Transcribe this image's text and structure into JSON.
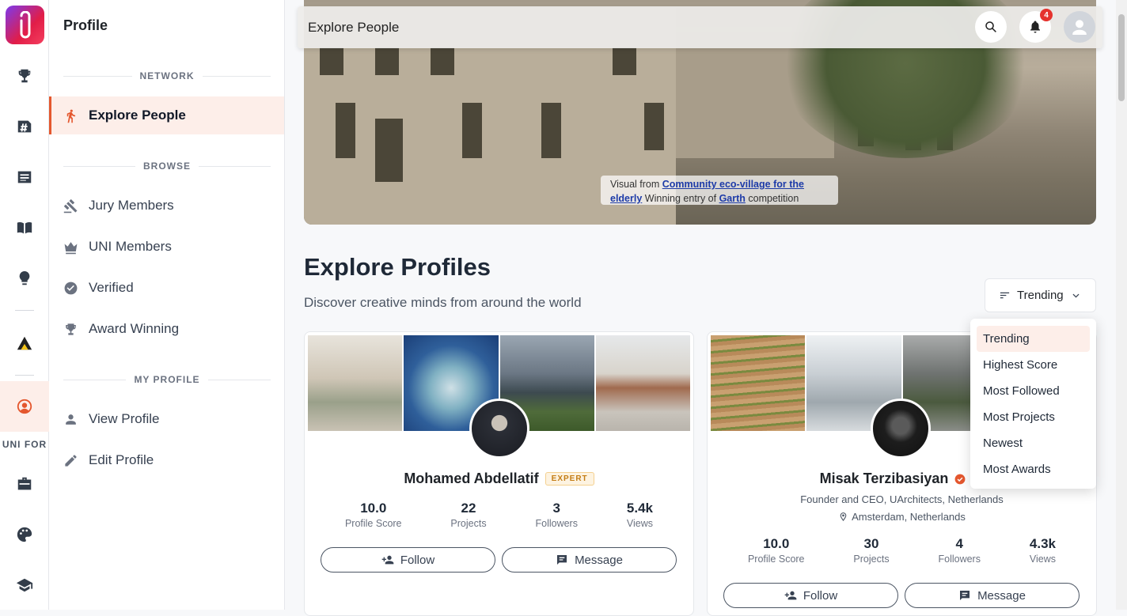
{
  "rail": {
    "label": "UNI FOR",
    "icons": [
      "trophy-icon",
      "hashtag-board-icon",
      "news-icon",
      "book-icon",
      "lightbulb-icon",
      "architecture-logo-icon",
      "profile-circle-icon",
      "briefcase-icon",
      "palette-icon",
      "graduation-cap-icon"
    ]
  },
  "sidenav": {
    "title": "Profile",
    "sections": {
      "network": "NETWORK",
      "browse": "BROWSE",
      "my_profile": "MY PROFILE"
    },
    "items": {
      "explore_people": "Explore People",
      "jury_members": "Jury Members",
      "uni_members": "UNI Members",
      "verified": "Verified",
      "award_winning": "Award Winning",
      "view_profile": "View Profile",
      "edit_profile": "Edit Profile"
    }
  },
  "topbar": {
    "title": "Explore People",
    "notification_count": "4"
  },
  "hero": {
    "caption_prefix": "Visual from ",
    "caption_link1": "Community eco-village for the elderly",
    "caption_mid": " Winning entry of ",
    "caption_link2": "Garth",
    "caption_suffix": " competition"
  },
  "main": {
    "heading": "Explore Profiles",
    "subheading": "Discover creative minds from around the world",
    "sort_label": "Trending"
  },
  "sort_options": [
    "Trending",
    "Highest Score",
    "Most Followed",
    "Most Projects",
    "Newest",
    "Most Awards"
  ],
  "profiles": [
    {
      "name": "Mohamed Abdellatif",
      "badge": "EXPERT",
      "stats": [
        {
          "value": "10.0",
          "label": "Profile Score"
        },
        {
          "value": "22",
          "label": "Projects"
        },
        {
          "value": "3",
          "label": "Followers"
        },
        {
          "value": "5.4k",
          "label": "Views"
        }
      ],
      "follow_label": "Follow",
      "message_label": "Message"
    },
    {
      "name": "Misak Terzibasiyan",
      "role": "Founder and CEO, UArchitects, Netherlands",
      "location": "Amsterdam, Netherlands",
      "stats": [
        {
          "value": "10.0",
          "label": "Profile Score"
        },
        {
          "value": "30",
          "label": "Projects"
        },
        {
          "value": "4",
          "label": "Followers"
        },
        {
          "value": "4.3k",
          "label": "Views"
        }
      ],
      "follow_label": "Follow",
      "message_label": "Message"
    }
  ],
  "colors": {
    "accent": "#e4572e",
    "accent_bg": "#fdeee9",
    "badge_red": "#e5322d",
    "expert_gold": "#c47d15"
  }
}
